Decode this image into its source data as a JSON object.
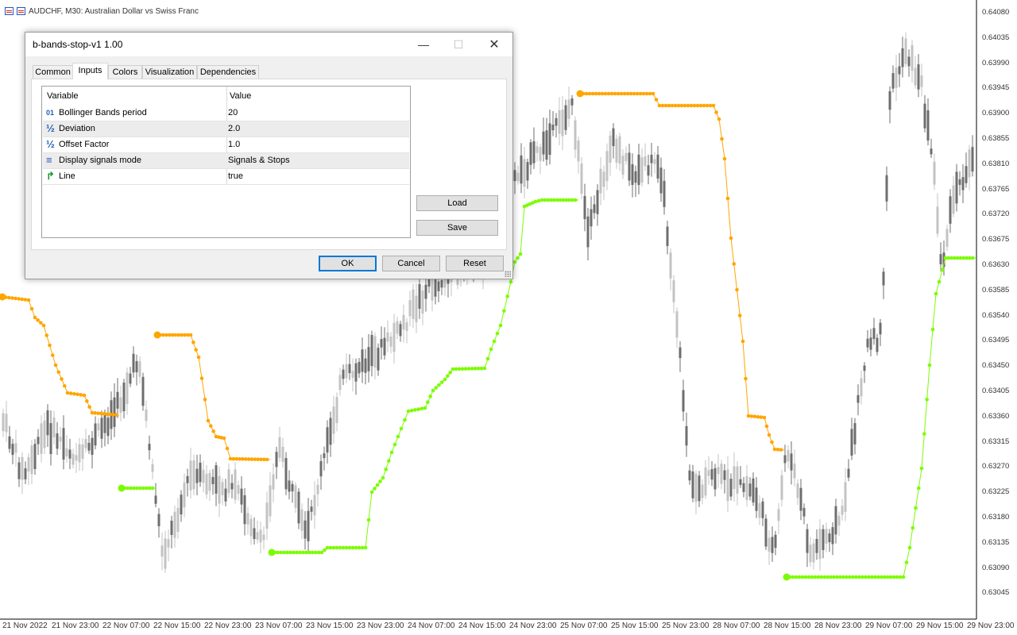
{
  "chart": {
    "symbol_title": "AUDCHF, M30:  Australian Dollar vs Swiss  Franc",
    "y_axis_labels": [
      "0.64080",
      "0.64035",
      "0.63990",
      "0.63945",
      "0.63900",
      "0.63855",
      "0.63810",
      "0.63765",
      "0.63720",
      "0.63675",
      "0.63630",
      "0.63585",
      "0.63540",
      "0.63495",
      "0.63450",
      "0.63405",
      "0.63360",
      "0.63315",
      "0.63270",
      "0.63225",
      "0.63180",
      "0.63135",
      "0.63090",
      "0.63045"
    ],
    "x_axis_labels": [
      "21 Nov 2022",
      "21 Nov 23:00",
      "22 Nov 07:00",
      "22 Nov 15:00",
      "22 Nov 23:00",
      "23 Nov 07:00",
      "23 Nov 15:00",
      "23 Nov 23:00",
      "24 Nov 07:00",
      "24 Nov 15:00",
      "24 Nov 23:00",
      "25 Nov 07:00",
      "25 Nov 15:00",
      "25 Nov 23:00",
      "28 Nov 07:00",
      "28 Nov 15:00",
      "28 Nov 23:00",
      "29 Nov 07:00",
      "29 Nov 15:00",
      "29 Nov 23:00"
    ],
    "colors": {
      "stop_down": "#ffa500",
      "stop_up": "#7cfc00",
      "candle_dark": "#6e6e6e",
      "candle_light": "#c3c3c3"
    }
  },
  "dialog": {
    "title": "b-bands-stop-v1 1.00",
    "tabs": [
      "Common",
      "Inputs",
      "Colors",
      "Visualization",
      "Dependencies"
    ],
    "active_tab": "Inputs",
    "table": {
      "headers": [
        "Variable",
        "Value"
      ],
      "rows": [
        {
          "icon": "integer-icon",
          "glyph": "01",
          "variable": "Bollinger Bands period",
          "value": "20"
        },
        {
          "icon": "double-icon",
          "glyph": "½",
          "variable": "Deviation",
          "value": "2.0"
        },
        {
          "icon": "double-icon",
          "glyph": "½",
          "variable": "Offset Factor",
          "value": "1.0"
        },
        {
          "icon": "enum-icon",
          "glyph": "≡",
          "variable": "Display signals mode",
          "value": "Signals & Stops"
        },
        {
          "icon": "bool-icon",
          "glyph": "↱",
          "variable": "Line",
          "value": "true"
        }
      ]
    },
    "buttons": {
      "load": "Load",
      "save": "Save",
      "ok": "OK",
      "cancel": "Cancel",
      "reset": "Reset"
    }
  }
}
